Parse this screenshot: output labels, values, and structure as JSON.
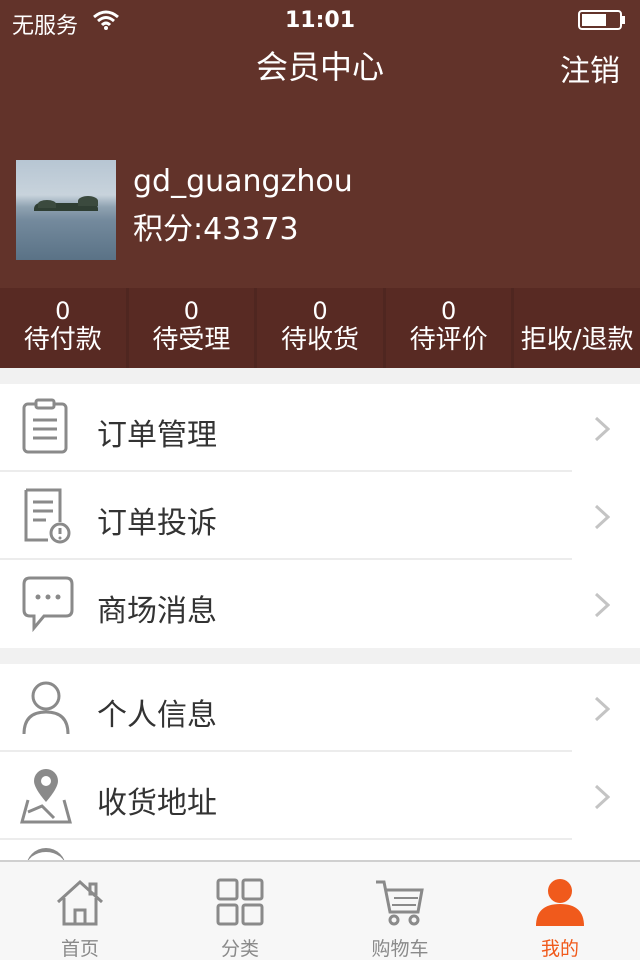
{
  "status_bar": {
    "carrier": "无服务",
    "time": "11:01",
    "icons": [
      "wifi-icon",
      "battery-icon"
    ]
  },
  "header": {
    "title": "会员中心",
    "logout_label": "注销"
  },
  "profile": {
    "username": "gd_guangzhou",
    "points_label": "积分:43373"
  },
  "order_status": [
    {
      "count": "0",
      "label": "待付款"
    },
    {
      "count": "0",
      "label": "待受理"
    },
    {
      "count": "0",
      "label": "待收货"
    },
    {
      "count": "0",
      "label": "待评价"
    },
    {
      "count": "",
      "label": "拒收/退款"
    }
  ],
  "menu_group1": [
    {
      "label": "订单管理",
      "icon": "clipboard-icon"
    },
    {
      "label": "订单投诉",
      "icon": "document-alert-icon"
    },
    {
      "label": "商场消息",
      "icon": "chat-bubble-icon"
    }
  ],
  "menu_group2": [
    {
      "label": "个人信息",
      "icon": "person-icon"
    },
    {
      "label": "收货地址",
      "icon": "map-pin-icon"
    }
  ],
  "tabbar": [
    {
      "label": "首页",
      "icon": "home-icon"
    },
    {
      "label": "分类",
      "icon": "grid-icon"
    },
    {
      "label": "购物车",
      "icon": "cart-icon"
    },
    {
      "label": "我的",
      "icon": "user-icon",
      "active": true
    }
  ],
  "colors": {
    "header_bg": "#62332a",
    "order_bar_bg": "#582a23",
    "accent": "#f05a1c",
    "icon_gray": "#8a8a8a"
  }
}
